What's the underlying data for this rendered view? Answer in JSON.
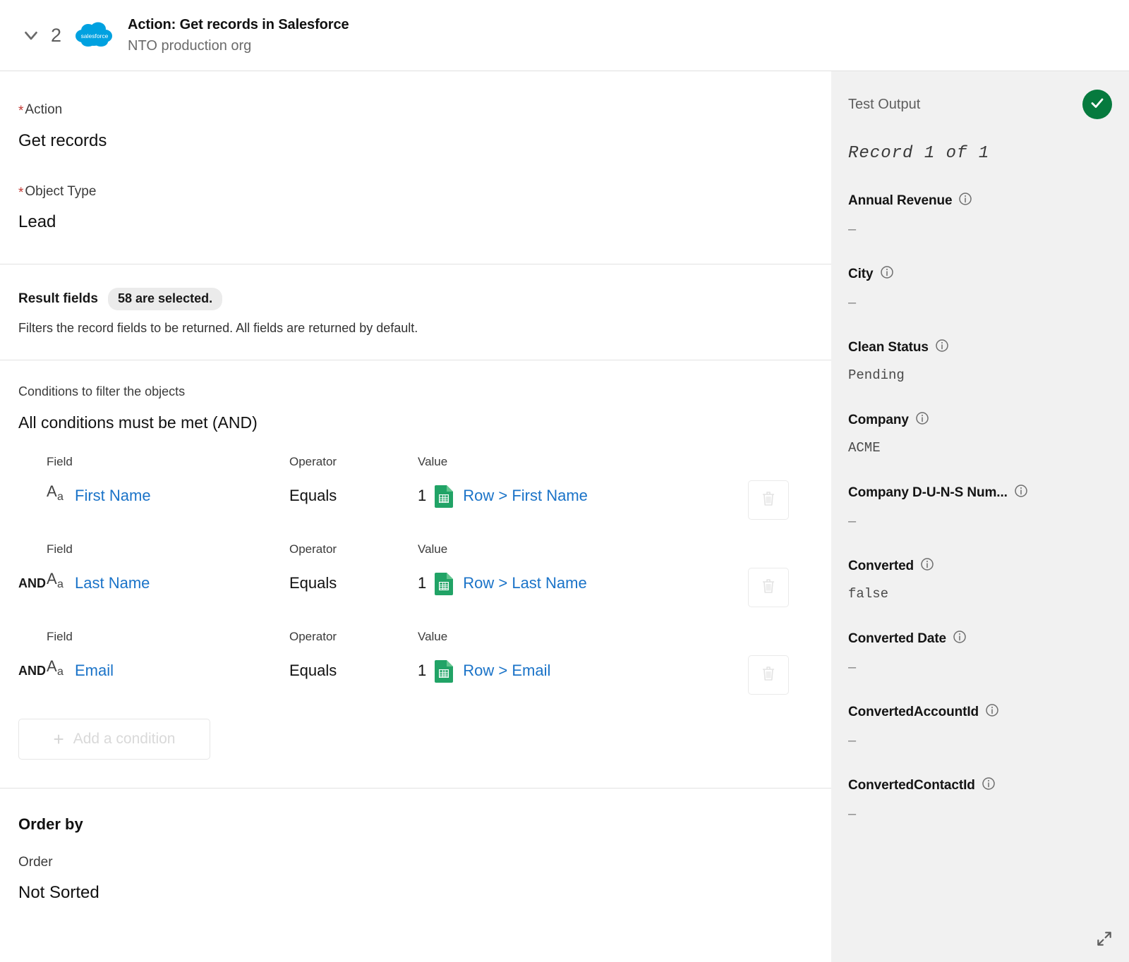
{
  "header": {
    "step_number": "2",
    "title": "Action: Get records in Salesforce",
    "subtitle": "NTO production org",
    "collapse_icon": "chevron-down-icon",
    "app_icon": "salesforce-logo",
    "app_icon_label": "salesforce"
  },
  "form": {
    "action": {
      "label": "Action",
      "required": true,
      "value": "Get records"
    },
    "object_type": {
      "label": "Object Type",
      "required": true,
      "value": "Lead"
    }
  },
  "result_fields": {
    "label": "Result fields",
    "badge": "58 are selected.",
    "description": "Filters the record fields to be returned. All fields are returned by default."
  },
  "conditions": {
    "intro": "Conditions to filter the objects",
    "mode": "All conditions must be met (AND)",
    "columns": {
      "field": "Field",
      "operator": "Operator",
      "value": "Value"
    },
    "items": [
      {
        "prefix": "",
        "field_icon": "text-field-icon",
        "field": "First Name",
        "operator": "Equals",
        "value_index": "1",
        "value_source_icon": "google-sheets-icon",
        "value": "Row > First Name",
        "delete_icon": "trash-icon"
      },
      {
        "prefix": "AND",
        "field_icon": "text-field-icon",
        "field": "Last Name",
        "operator": "Equals",
        "value_index": "1",
        "value_source_icon": "google-sheets-icon",
        "value": "Row > Last Name",
        "delete_icon": "trash-icon"
      },
      {
        "prefix": "AND",
        "field_icon": "text-field-icon",
        "field": "Email",
        "operator": "Equals",
        "value_index": "1",
        "value_source_icon": "google-sheets-icon",
        "value": "Row > Email",
        "delete_icon": "trash-icon"
      }
    ],
    "add_button": {
      "label": "Add a condition",
      "icon": "plus-icon"
    }
  },
  "order_by": {
    "title": "Order by",
    "label": "Order",
    "value": "Not Sorted"
  },
  "test_output": {
    "title": "Test Output",
    "status_icon": "check-circle-icon",
    "status_color": "#067a3e",
    "record_count": "Record 1 of 1",
    "info_icon": "info-circle-icon",
    "expand_icon": "expand-diagonal-icon",
    "fields": [
      {
        "name": "Annual Revenue",
        "value": "–"
      },
      {
        "name": "City",
        "value": "–"
      },
      {
        "name": "Clean Status",
        "value": "Pending"
      },
      {
        "name": "Company",
        "value": "ACME"
      },
      {
        "name": "Company D-U-N-S Num...",
        "value": "–"
      },
      {
        "name": "Converted",
        "value": "false"
      },
      {
        "name": "Converted Date",
        "value": "–"
      },
      {
        "name": "ConvertedAccountId",
        "value": "–"
      },
      {
        "name": "ConvertedContactId",
        "value": "–"
      }
    ]
  },
  "colors": {
    "link": "#1a73c8",
    "required": "#c23934",
    "success": "#067a3e",
    "salesforce_blue": "#00a1e0",
    "sheets_green": "#21a366",
    "panel_bg": "#f1f1f1"
  }
}
